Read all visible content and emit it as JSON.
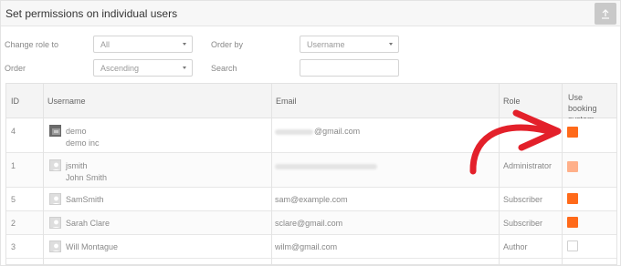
{
  "header": {
    "title": "Set permissions on individual users"
  },
  "filters": {
    "change_role_label": "Change role to",
    "change_role_value": "All",
    "order_by_label": "Order by",
    "order_by_value": "Username",
    "order_label": "Order",
    "order_value": "Ascending",
    "search_label": "Search",
    "search_value": ""
  },
  "table": {
    "columns": {
      "id": "ID",
      "username": "Username",
      "email": "Email",
      "role": "Role",
      "booking": "Use booking system"
    },
    "rows": [
      {
        "id": "4",
        "username": "demo",
        "fullname": "demo inc",
        "email_visible": "@gmail.com",
        "role": "",
        "booking": "on",
        "avatar": "photo"
      },
      {
        "id": "1",
        "username": "jsmith",
        "fullname": "John Smith",
        "email_visible": "",
        "role": "Administrator",
        "booking": "partial",
        "avatar": "placeholder"
      },
      {
        "id": "5",
        "username": "SamSmith",
        "fullname": "",
        "email_visible": "sam@example.com",
        "role": "Subscriber",
        "booking": "on",
        "avatar": "placeholder"
      },
      {
        "id": "2",
        "username": "Sarah Clare",
        "fullname": "",
        "email_visible": "sclare@gmail.com",
        "role": "Subscriber",
        "booking": "on",
        "avatar": "placeholder"
      },
      {
        "id": "3",
        "username": "Will Montague",
        "fullname": "",
        "email_visible": "wilm@gmail.com",
        "role": "Author",
        "booking": "off",
        "avatar": "placeholder"
      }
    ]
  },
  "colors": {
    "checkbox_on": "#ff6a1a",
    "checkbox_partial": "#ffb08a",
    "arrow": "#e3202a"
  },
  "icons": {
    "upload": "upload-icon",
    "avatar_placeholder": "user-avatar-icon",
    "caret": "chevron-down-icon"
  }
}
